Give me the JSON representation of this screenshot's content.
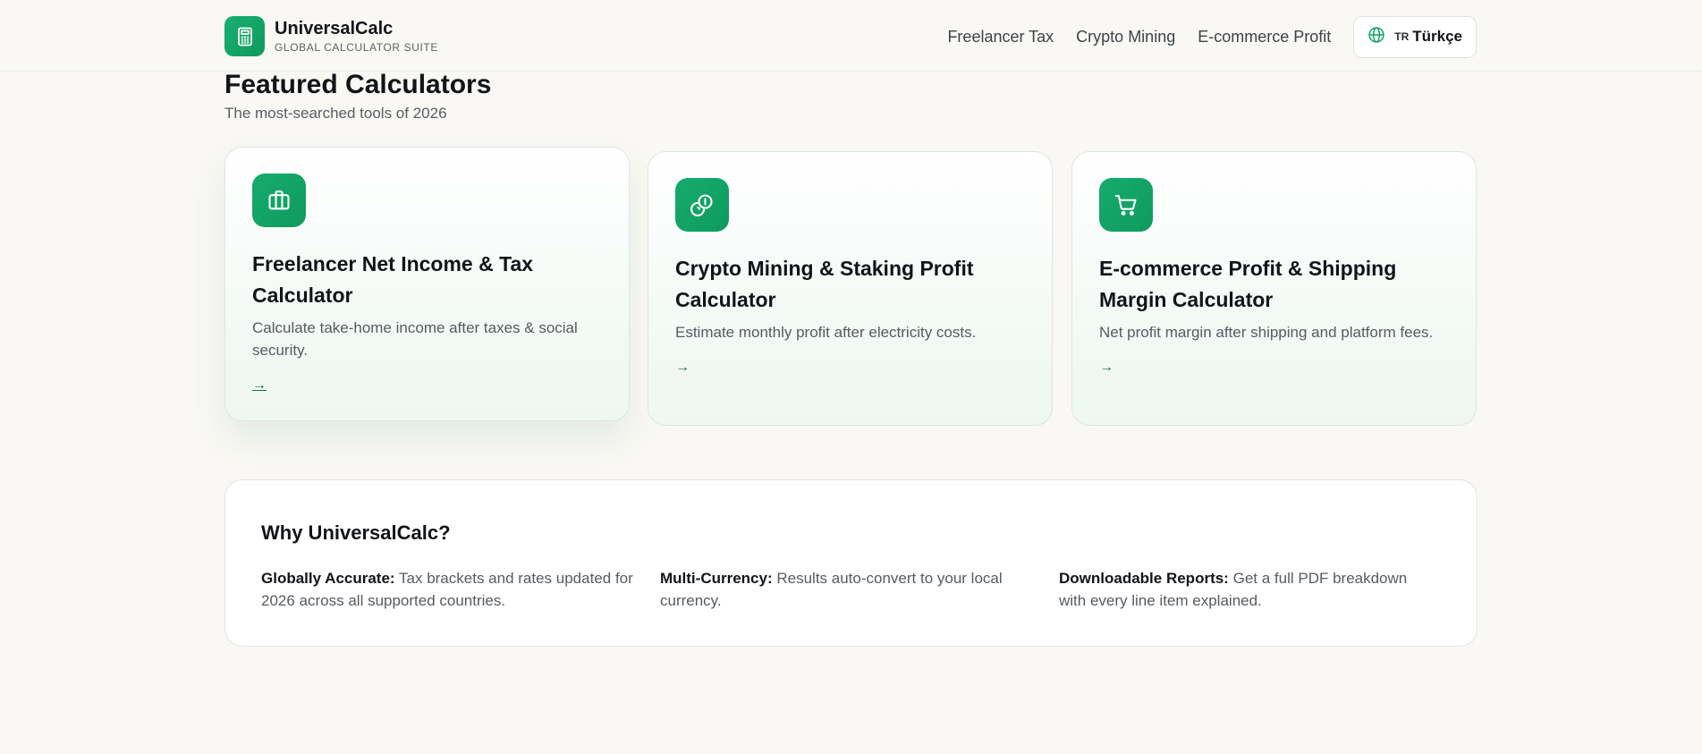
{
  "header": {
    "brand_name": "UniversalCalc",
    "brand_tagline": "GLOBAL CALCULATOR SUITE",
    "logo_icon": "calculator-icon",
    "nav": [
      {
        "label": "Freelancer Tax"
      },
      {
        "label": "Crypto Mining"
      },
      {
        "label": "E-commerce Profit"
      }
    ],
    "language": {
      "code": "TR",
      "label": "Türkçe",
      "icon": "globe-icon"
    }
  },
  "featured": {
    "title": "Featured Calculators",
    "subtitle": "The most-searched tools of 2026",
    "cards": [
      {
        "icon": "briefcase-icon",
        "title": "Freelancer Net Income & Tax Calculator",
        "description": "Calculate take-home income after taxes & social security.",
        "arrow": "→"
      },
      {
        "icon": "coins-icon",
        "title": "Crypto Mining & Staking Profit Calculator",
        "description": "Estimate monthly profit after electricity costs.",
        "arrow": "→"
      },
      {
        "icon": "cart-icon",
        "title": "E-commerce Profit & Shipping Margin Calculator",
        "description": "Net profit margin after shipping and platform fees.",
        "arrow": "→"
      }
    ]
  },
  "why": {
    "title": "Why UniversalCalc?",
    "items": [
      {
        "heading": "Globally Accurate:",
        "text": "Tax brackets and rates updated for 2026 across all supported countries."
      },
      {
        "heading": "Multi-Currency:",
        "text": "Results auto-convert to your local currency."
      },
      {
        "heading": "Downloadable Reports:",
        "text": "Get a full PDF breakdown with every line item explained."
      }
    ]
  },
  "colors": {
    "accent": "#12a366",
    "background": "#f9f8f4",
    "text": "#111418",
    "muted": "#555c61"
  }
}
